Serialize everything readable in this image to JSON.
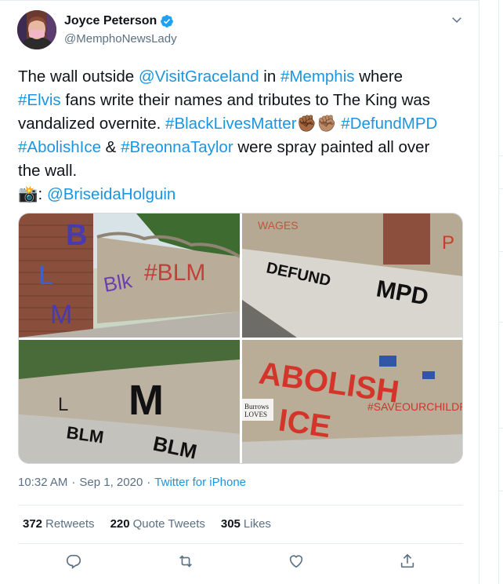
{
  "author": {
    "name": "Joyce Peterson",
    "handle": "@MemphoNewsLady",
    "verified": true
  },
  "tweet": {
    "lines": [
      [
        {
          "t": "The wall outside "
        },
        {
          "t": "@VisitGraceland",
          "link": true
        },
        {
          "t": " in "
        },
        {
          "t": "#Memphis",
          "link": true
        },
        {
          "t": " where"
        }
      ],
      [
        {
          "t": "#Elvis",
          "link": true
        },
        {
          "t": " fans write their names and tributes to The King was"
        }
      ],
      [
        {
          "t": "vandalized overnite. "
        },
        {
          "t": "#BlackLivesMatter",
          "link": true
        },
        {
          "t": "✊🏾✊🏽",
          "emoji": true
        },
        {
          "t": " "
        },
        {
          "t": "#DefundMPD",
          "link": true
        }
      ],
      [
        {
          "t": "#AbolishIce",
          "link": true
        },
        {
          "t": " & "
        },
        {
          "t": "#BreonnaTaylor",
          "link": true
        },
        {
          "t": " were spray painted all over"
        }
      ],
      [
        {
          "t": "the wall."
        }
      ],
      [
        {
          "t": "📸",
          "emoji": true
        },
        {
          "t": ": "
        },
        {
          "t": "@BriseidaHolguin",
          "link": true
        }
      ]
    ]
  },
  "meta": {
    "time": "10:32 AM",
    "dot1": "·",
    "date": "Sep 1, 2020",
    "dot2": "·",
    "source": "Twitter for iPhone"
  },
  "stats": {
    "retweets_count": "372",
    "retweets_label": "Retweets",
    "quotes_count": "220",
    "quotes_label": "Quote Tweets",
    "likes_count": "305",
    "likes_label": "Likes"
  },
  "photos": [
    {
      "name": "photo-wall-blm-graffiti",
      "paint": "B L M  #BLM  Black"
    },
    {
      "name": "photo-sidewalk-defund-mpd",
      "paint": "DEFUND MPD"
    },
    {
      "name": "photo-wall-blm-sidewalk",
      "paint": "M  BLM"
    },
    {
      "name": "photo-wall-abolish-ice",
      "paint": "ABOLISH ICE  #SAVEOURCHILDREN"
    }
  ],
  "colors": {
    "link": "#1b95e0",
    "muted": "#5b7083",
    "text": "#0f1419",
    "border": "#e6ecf0"
  },
  "icons": [
    "verified-badge-icon",
    "chevron-down-icon",
    "reply-icon",
    "retweet-icon",
    "like-icon",
    "share-icon"
  ]
}
